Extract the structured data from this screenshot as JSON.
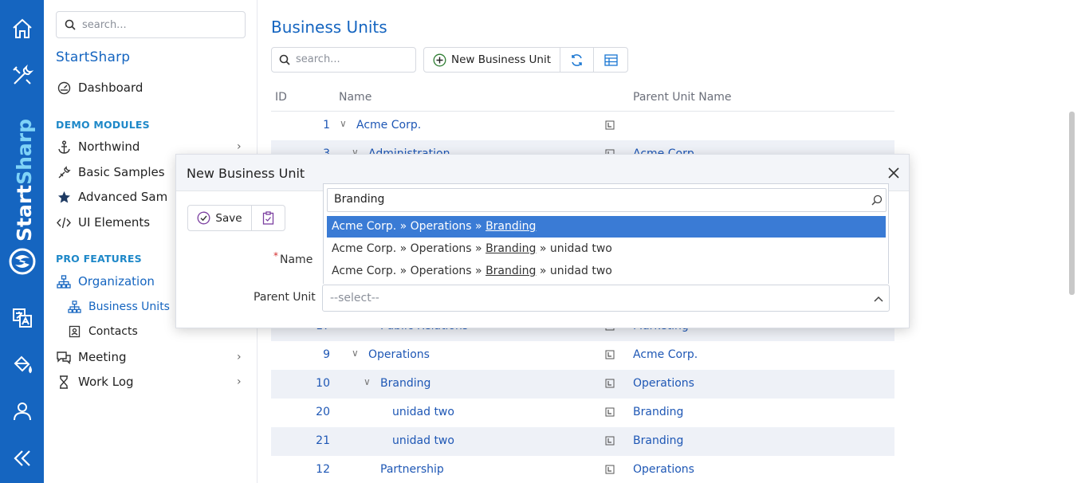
{
  "brand": {
    "word_a": "Start",
    "word_b": "Sharp"
  },
  "sidebar": {
    "search_placeholder": "search...",
    "title": "StartSharp",
    "dashboard": "Dashboard",
    "demo_header": "DEMO MODULES",
    "demo_items": [
      "Northwind",
      "Basic Samples",
      "Advanced Sam",
      "UI Elements"
    ],
    "pro_header": "PRO FEATURES",
    "organization": "Organization",
    "org_sub": [
      "Business Units",
      "Contacts"
    ],
    "meeting": "Meeting",
    "worklog": "Work Log"
  },
  "page": {
    "title": "Business Units",
    "search_placeholder": "search...",
    "new_button": "New Business Unit"
  },
  "grid": {
    "columns": [
      "ID",
      "Name",
      "Parent Unit Name"
    ],
    "rows": [
      {
        "id": "1",
        "name": "Acme Corp.",
        "toggle": "∨",
        "parent": ""
      },
      {
        "id": "3",
        "name": "Administration",
        "toggle": "∨",
        "parent": "Acme Corp."
      },
      {
        "id": "17",
        "name": "Public Relations",
        "toggle": "",
        "parent": "Marketing"
      },
      {
        "id": "9",
        "name": "Operations",
        "toggle": "∨",
        "parent": "Acme Corp."
      },
      {
        "id": "10",
        "name": "Branding",
        "toggle": "∨",
        "parent": "Operations"
      },
      {
        "id": "20",
        "name": "unidad two",
        "toggle": "",
        "parent": "Branding"
      },
      {
        "id": "21",
        "name": "unidad two",
        "toggle": "",
        "parent": "Branding"
      },
      {
        "id": "12",
        "name": "Partnership",
        "toggle": "",
        "parent": "Operations"
      }
    ]
  },
  "dialog": {
    "title": "New Business Unit",
    "save_label": "Save",
    "name_label": "Name",
    "required_mark": "*",
    "parent_label": "Parent Unit",
    "parent_placeholder": "--select--",
    "dropdown_search_value": "Branding",
    "options": [
      {
        "prefix": "Acme Corp. » Operations » ",
        "match": "Branding",
        "suffix": ""
      },
      {
        "prefix": "Acme Corp. » Operations » ",
        "match": "Branding",
        "suffix": " » unidad two"
      },
      {
        "prefix": "Acme Corp. » Operations » ",
        "match": "Branding",
        "suffix": " » unidad two"
      }
    ]
  }
}
